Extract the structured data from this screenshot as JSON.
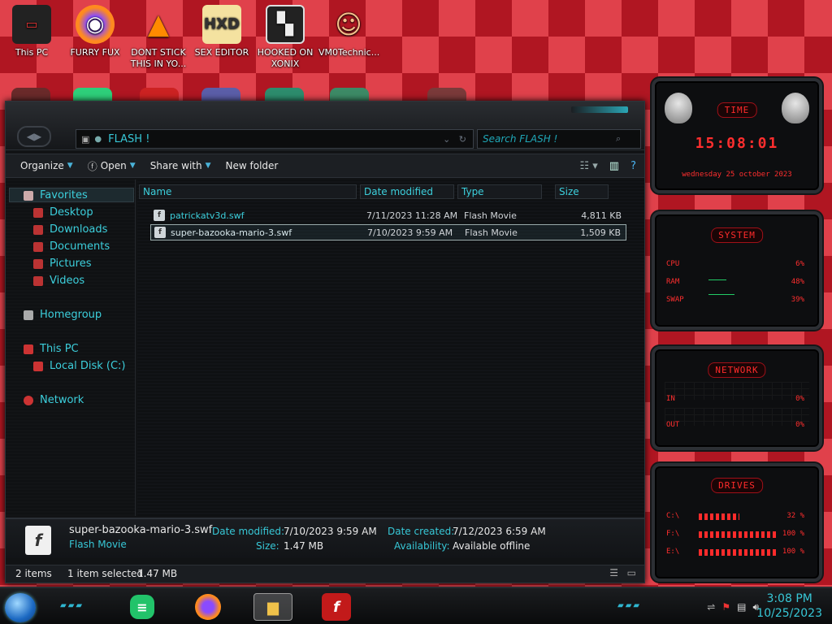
{
  "desktop": {
    "icons": [
      {
        "label": "This PC",
        "icon": "computer-icon"
      },
      {
        "label": "FURRY FUX",
        "icon": "firefox-icon"
      },
      {
        "label": "DONT STICK THIS IN YO...",
        "icon": "vlc-icon"
      },
      {
        "label": "SEX EDITOR",
        "icon": "hxd-icon"
      },
      {
        "label": "HOOKED ON XONIX",
        "icon": "game-icon"
      },
      {
        "label": "VM0Technic...",
        "icon": "doctor-icon"
      }
    ]
  },
  "explorer": {
    "address": {
      "path": "FLASH !"
    },
    "search": {
      "placeholder": "Search FLASH !"
    },
    "toolbar": {
      "organize": "Organize",
      "open": "Open",
      "share_with": "Share with",
      "new_folder": "New folder"
    },
    "sidebar": {
      "favorites": "Favorites",
      "desktop": "Desktop",
      "downloads": "Downloads",
      "documents": "Documents",
      "pictures": "Pictures",
      "videos": "Videos",
      "homegroup": "Homegroup",
      "this_pc": "This PC",
      "local_disk": "Local Disk (C:)",
      "network": "Network"
    },
    "columns": {
      "name": "Name",
      "date_modified": "Date modified",
      "type": "Type",
      "size": "Size"
    },
    "files": [
      {
        "name": "patrickatv3d.swf",
        "date": "7/11/2023 11:28 AM",
        "type": "Flash Movie",
        "size": "4,811 KB"
      },
      {
        "name": "super-bazooka-mario-3.swf",
        "date": "7/10/2023 9:59 AM",
        "type": "Flash Movie",
        "size": "1,509 KB"
      }
    ],
    "details": {
      "filename": "super-bazooka-mario-3.swf",
      "filetype": "Flash Movie",
      "date_modified_label": "Date modified:",
      "date_modified": "7/10/2023 9:59 AM",
      "size_label": "Size:",
      "size": "1.47 MB",
      "date_created_label": "Date created:",
      "date_created": "7/12/2023 6:59 AM",
      "availability_label": "Availability:",
      "availability": "Available offline"
    },
    "status": {
      "items": "2 items",
      "selected": "1 item selected",
      "selected_size": "1.47 MB"
    }
  },
  "gadgets": {
    "time": {
      "title": "TIME",
      "clock": "15:08:01",
      "date": "wednesday 25 october 2023"
    },
    "system": {
      "title": "SYSTEM",
      "rows": [
        {
          "label": "CPU",
          "value": "6%"
        },
        {
          "label": "RAM",
          "value": "48%"
        },
        {
          "label": "SWAP",
          "value": "39%"
        }
      ]
    },
    "network": {
      "title": "NETWORK",
      "rows": [
        {
          "label": "IN",
          "value": "0%"
        },
        {
          "label": "OUT",
          "value": "0%"
        }
      ]
    },
    "drives": {
      "title": "DRIVES",
      "rows": [
        {
          "label": "C:\\",
          "value": "32 %"
        },
        {
          "label": "F:\\",
          "value": "100 %"
        },
        {
          "label": "E:\\",
          "value": "100 %"
        }
      ]
    }
  },
  "taskbar": {
    "time": "3:08 PM",
    "date": "10/25/2023"
  },
  "colors": {
    "accent": "#37c7d6",
    "gadget_red": "#ff2e2e",
    "desktop_red": "#c0202c"
  }
}
